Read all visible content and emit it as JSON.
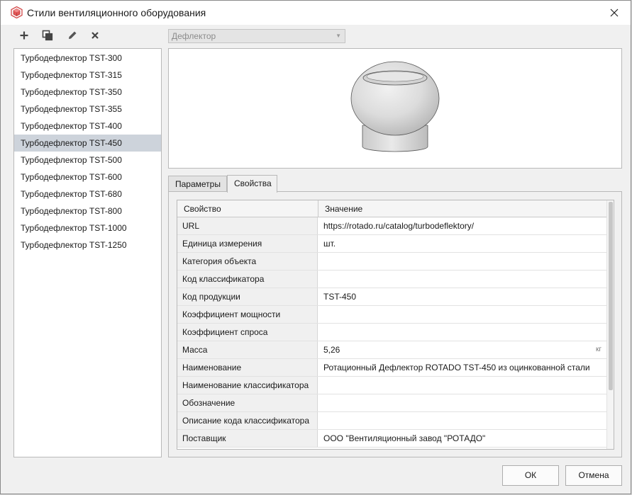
{
  "window": {
    "title": "Стили вентиляционного оборудования",
    "close_glyph": "✕"
  },
  "toolbar": {
    "add_glyph": "+",
    "copy_icon": "copy-icon",
    "edit_icon": "pencil-icon",
    "delete_glyph": "✕"
  },
  "styles_list": {
    "items": [
      "Турбодефлектор TST-300",
      "Турбодефлектор TST-315",
      "Турбодефлектор TST-350",
      "Турбодефлектор TST-355",
      "Турбодефлектор TST-400",
      "Турбодефлектор TST-450",
      "Турбодефлектор TST-500",
      "Турбодефлектор TST-600",
      "Турбодефлектор TST-680",
      "Турбодефлектор TST-800",
      "Турбодефлектор TST-1000",
      "Турбодефлектор TST-1250"
    ],
    "selected_index": 5
  },
  "type_combo": {
    "value": "Дефлектор",
    "arrow": "▼"
  },
  "tabs": {
    "parameters": "Параметры",
    "properties": "Свойства",
    "active": "properties"
  },
  "properties_table": {
    "header_property": "Свойство",
    "header_value": "Значение",
    "rows": [
      {
        "property": "URL",
        "value": "https://rotado.ru/catalog/turbodeflektory/",
        "unit": ""
      },
      {
        "property": "Единица измерения",
        "value": "шт.",
        "unit": ""
      },
      {
        "property": "Категория объекта",
        "value": "",
        "unit": ""
      },
      {
        "property": "Код классификатора",
        "value": "",
        "unit": ""
      },
      {
        "property": "Код продукции",
        "value": "TST-450",
        "unit": ""
      },
      {
        "property": "Коэффициент мощности",
        "value": "",
        "unit": ""
      },
      {
        "property": "Коэффициент спроса",
        "value": "",
        "unit": ""
      },
      {
        "property": "Масса",
        "value": "5,26",
        "unit": "кг"
      },
      {
        "property": "Наименование",
        "value": "Ротационный Дефлектор ROTADO TST-450 из оцинкованной стали",
        "unit": ""
      },
      {
        "property": "Наименование классификатора",
        "value": "",
        "unit": ""
      },
      {
        "property": "Обозначение",
        "value": "",
        "unit": ""
      },
      {
        "property": "Описание кода классификатора",
        "value": "",
        "unit": ""
      },
      {
        "property": "Поставщик",
        "value": "ООО \"Вентиляционный завод \"РОТАДО\"",
        "unit": ""
      }
    ]
  },
  "buttons": {
    "ok": "ОК",
    "cancel": "Отмена"
  },
  "colors": {
    "selection": "#cdd3db",
    "window_bg": "#f0f0f0"
  }
}
